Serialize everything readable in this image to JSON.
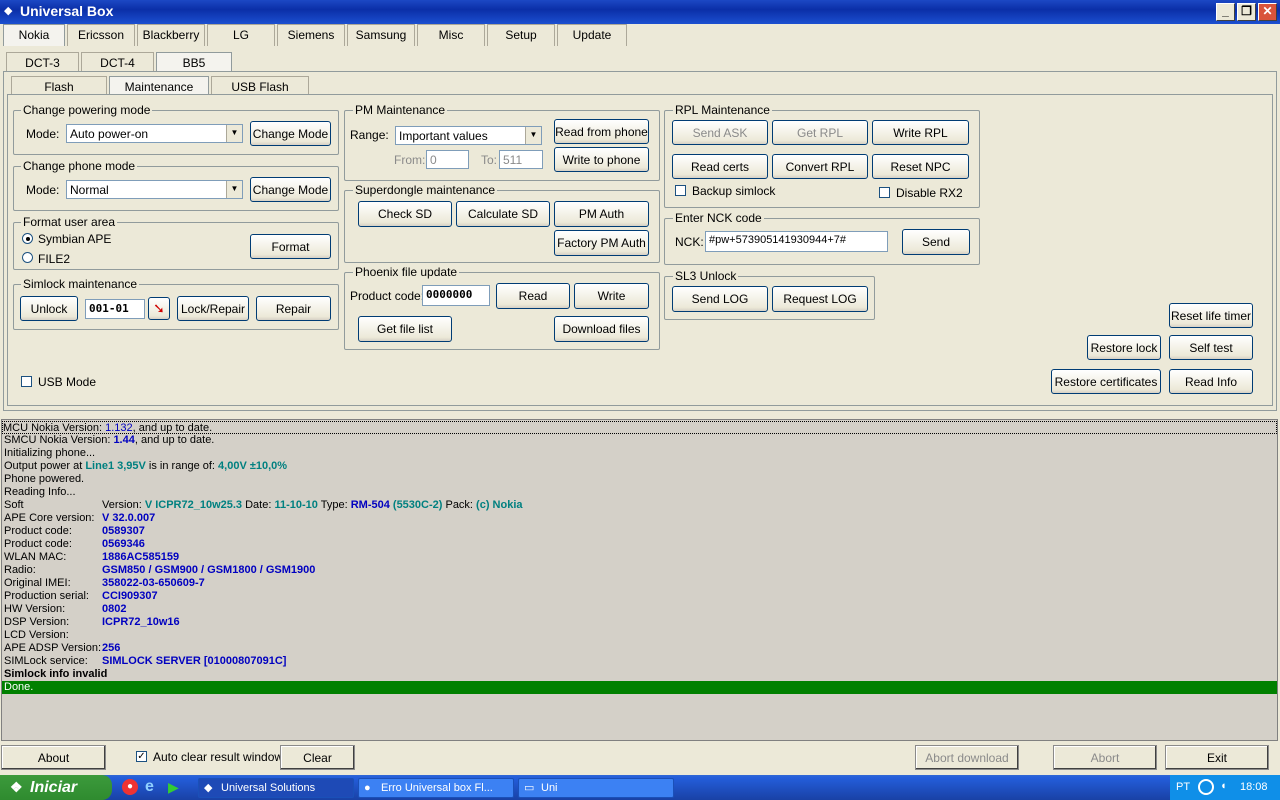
{
  "window": {
    "title": "Universal Box"
  },
  "brand_tabs": [
    "Nokia",
    "Ericsson",
    "Blackberry",
    "LG",
    "Siemens",
    "Samsung",
    "Misc",
    "Setup",
    "Update"
  ],
  "model_tabs": [
    "DCT-3",
    "DCT-4",
    "BB5"
  ],
  "func_tabs": [
    "Flash",
    "Maintenance",
    "USB Flash"
  ],
  "powering": {
    "title": "Change powering mode",
    "mode_label": "Mode:",
    "mode_value": "Auto power-on",
    "button": "Change Mode"
  },
  "phonemode": {
    "title": "Change phone mode",
    "mode_label": "Mode:",
    "mode_value": "Normal",
    "button": "Change Mode"
  },
  "format": {
    "title": "Format user area",
    "opt1": "Symbian APE",
    "opt2": "FILE2",
    "button": "Format"
  },
  "simlock": {
    "title": "Simlock maintenance",
    "unlock": "Unlock",
    "code": "001-01",
    "lock": "Lock/Repair",
    "repair": "Repair"
  },
  "usb_mode": "USB Mode",
  "pm": {
    "title": "PM Maintenance",
    "range_label": "Range:",
    "range_value": "Important values",
    "from_label": "From:",
    "from_value": "0",
    "to_label": "To:",
    "to_value": "511",
    "read": "Read from phone",
    "write": "Write to phone"
  },
  "superdongle": {
    "title": "Superdongle maintenance",
    "check": "Check SD",
    "calc": "Calculate SD",
    "pmauth": "PM Auth",
    "factory": "Factory PM Auth"
  },
  "phoenix": {
    "title": "Phoenix file update",
    "product_label": "Product code:",
    "product_value": "0000000",
    "read": "Read",
    "write": "Write",
    "list": "Get file list",
    "download": "Download files"
  },
  "rpl": {
    "title": "RPL Maintenance",
    "send_ask": "Send ASK",
    "get_rpl": "Get RPL",
    "write_rpl": "Write RPL",
    "read_certs": "Read certs",
    "convert_rpl": "Convert RPL",
    "reset_npc": "Reset NPC",
    "backup": "Backup simlock",
    "disable_rx2": "Disable RX2"
  },
  "nck": {
    "title": "Enter NCK code",
    "label": "NCK:",
    "value": "#pw+573905141930944+7#",
    "send": "Send"
  },
  "sl3": {
    "title": "SL3 Unlock",
    "send_log": "Send LOG",
    "request_log": "Request LOG"
  },
  "right": {
    "reset_life": "Reset life timer",
    "restore_lock": "Restore lock",
    "self_test": "Self test",
    "restore_certs": "Restore certificates",
    "read_info": "Read Info"
  },
  "log": {
    "l1a": "MCU Nokia Version: ",
    "l1b": "1.132",
    "l1c": ", and up to date.",
    "l2a": "SMCU Nokia Version: ",
    "l2b": "1.44",
    "l2c": ", and up to date.",
    "l3": "Initializing phone...",
    "l4a": "Output power at ",
    "l4b": "Line1 3,95V",
    "l4c": " is in range of: ",
    "l4d": "4,00V ±10,0%",
    "l5": "Phone powered.",
    "l6": "Reading Info...",
    "soft_label": "Soft",
    "soft_v1": "Version: ",
    "soft_v2": "V ICPR72_10w25.3",
    "soft_v3": " Date: ",
    "soft_v4": "11-10-10",
    "soft_v5": " Type: ",
    "soft_v6": "RM-504",
    "soft_v7": " (5530C-2)",
    "soft_v8": " Pack: ",
    "soft_v9": "(c) Nokia",
    "rows": [
      {
        "k": "APE Core version:",
        "v": "V 32.0.007"
      },
      {
        "k": "Product code:",
        "v": "0589307"
      },
      {
        "k": "Product code:",
        "v": "0569346"
      },
      {
        "k": "WLAN MAC:",
        "v": "1886AC585159"
      },
      {
        "k": "Radio:",
        "v": "GSM850 / GSM900 / GSM1800 / GSM1900"
      },
      {
        "k": "Original IMEI:",
        "v": "358022-03-650609-7"
      },
      {
        "k": "Production serial:",
        "v": "CCI909307"
      },
      {
        "k": "HW Version:",
        "v": "0802"
      },
      {
        "k": "DSP Version:",
        "v": "ICPR72_10w16"
      },
      {
        "k": "LCD Version:",
        "v": ""
      },
      {
        "k": "APE ADSP Version:",
        "v": "256"
      },
      {
        "k": "SIMLock service:",
        "v": "SIMLOCK SERVER [01000807091C]"
      }
    ],
    "invalid": "Simlock info invalid",
    "done": "Done."
  },
  "bottom": {
    "about": "About",
    "auto_clear": "Auto clear result window",
    "clear": "Clear",
    "abort_download": "Abort download",
    "abort": "Abort",
    "exit": "Exit"
  },
  "taskbar": {
    "start": "Iniciar",
    "t1": "Universal Solutions",
    "t2": "Erro Universal box Fl...",
    "t3": "Uni",
    "lang": "PT",
    "time": "18:08"
  }
}
